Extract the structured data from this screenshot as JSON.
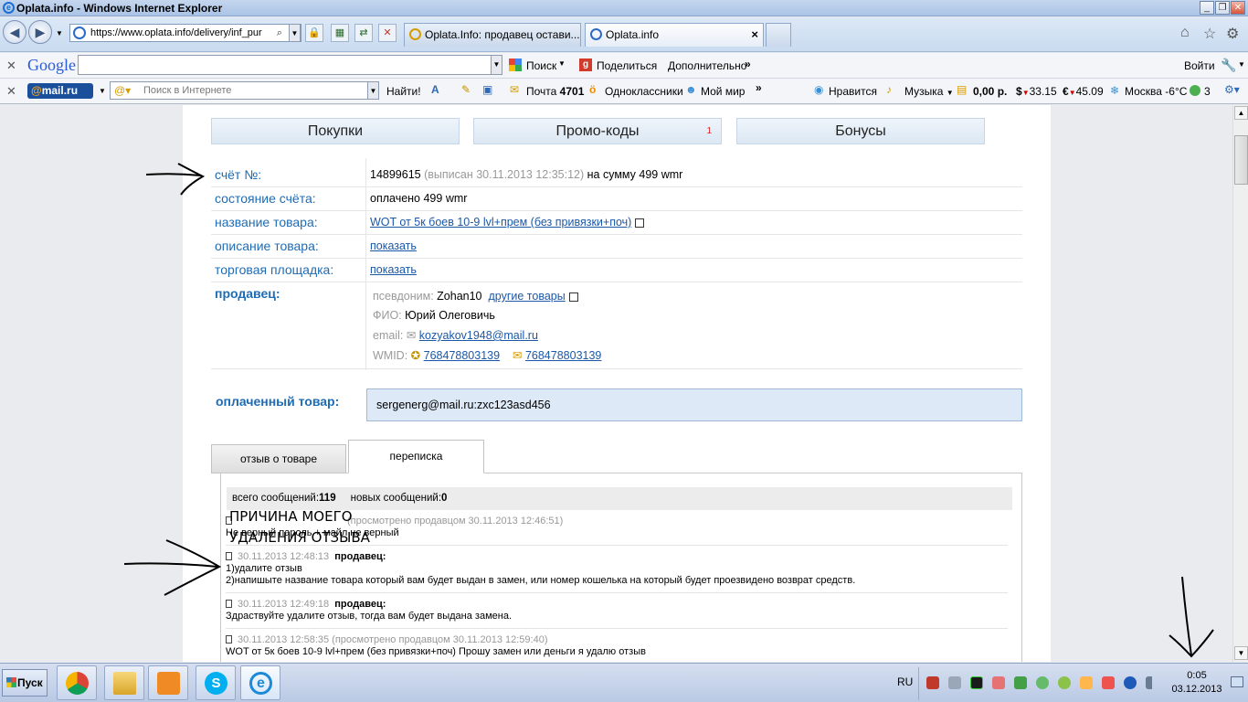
{
  "window": {
    "title": "Oplata.info - Windows Internet Explorer"
  },
  "navbar": {
    "url": "https://www.oplata.info/delivery/inf_pur",
    "tabs": [
      {
        "label": "Oplata.Info: продавец остави..."
      },
      {
        "label": "Oplata.info"
      }
    ]
  },
  "google_bar": {
    "logo": "Google",
    "search_label": "Поиск",
    "share_label": "Поделиться",
    "more_label": "Дополнительно",
    "login_label": "Войти"
  },
  "mail_bar": {
    "logo_at": "@",
    "logo_text": "mail.ru",
    "search_placeholder": "Поиск в Интернете",
    "find_label": "Найти!",
    "mail_label": "Почта",
    "mail_count": "4701",
    "ok_label": "Одноклассники",
    "mymir_label": "Мой мир",
    "like_label": "Нравится",
    "music_label": "Музыка",
    "balance": "0,00 р.",
    "usd": "33.15",
    "eur": "45.09",
    "weather": "Москва -6°C",
    "badge": "3"
  },
  "top_tabs": [
    {
      "label": "Покупки"
    },
    {
      "label": "Промо-коды",
      "count": "1"
    },
    {
      "label": "Бонусы"
    }
  ],
  "invoice": {
    "number_label": "счёт №:",
    "number": "14899615",
    "issued": "(выписан 30.11.2013 12:35:12)",
    "sum": "на сумму 499 wmr",
    "state_label": "состояние счёта:",
    "state": "оплачено 499 wmr",
    "product_label": "название товара:",
    "product": "WOT от 5к боев 10-9 lvl+прем (без привязки+поч)",
    "desc_label": "описание товара:",
    "desc_link": "показать",
    "market_label": "торговая площадка:",
    "market_link": "показать",
    "seller_label": "продавец:",
    "nick_label": "псевдоним:",
    "nick": "Zohan10",
    "other_goods": "другие товары",
    "fio_label": "ФИО:",
    "fio": "Юрий Олеговичь",
    "email_label": "email:",
    "email": "kozyakov1948@mail.ru",
    "wmid_label": "WMID:",
    "wmid1": "768478803139",
    "wmid2": "768478803139",
    "paid_label": "оплаченный товар:",
    "paid_value": "sergenerg@mail.ru:zxc123asd456"
  },
  "content_tabs": [
    {
      "label": "отзыв о товаре"
    },
    {
      "label": "переписка"
    }
  ],
  "messages_head": {
    "total_label": "всего сообщений:",
    "total": "119",
    "new_label": "новых сообщений:",
    "new": "0"
  },
  "messages": [
    {
      "meta": "(просмотрено продавцом 30.11.2013 12:46:51)",
      "text": "Не верный пароль + майл не верный"
    },
    {
      "meta": "30.11.2013 12:48:13",
      "author": "продавец:",
      "text1": "1)удалите отзыв",
      "text2": "2)напишыте название товара который вам будет выдан в замен, или номер кошелька на который будет проезвидено возврат средств."
    },
    {
      "meta": "30.11.2013 12:49:18",
      "author": "продавец:",
      "text": "Здраствуйте удалите отзыв, тогда вам будет выдана замена."
    },
    {
      "meta": "30.11.2013 12:58:35  (просмотрено продавцом 30.11.2013 12:59:40)",
      "text": "WOT от 5к боев 10-9 lvl+прем (без привязки+поч) Прошу замен или деньги я удалю отзыв"
    }
  ],
  "annotation": {
    "line1": "ПРИЧИНА МОЕГО",
    "line2": "УДАЛЕНИЯ ОТЗЫВА"
  },
  "taskbar": {
    "start_label": "Пуск",
    "lang": "RU",
    "time": "0:05",
    "date": "03.12.2013"
  }
}
